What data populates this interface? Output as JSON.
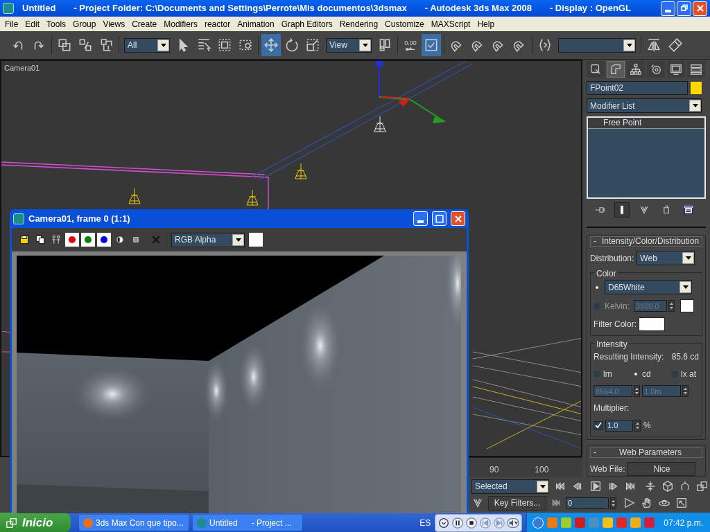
{
  "window": {
    "title_parts": [
      "Untitled",
      "- Project Folder: C:\\Documents and Settings\\Perrote\\Mis documentos\\3dsmax",
      "- Autodesk 3ds Max 2008",
      "- Display : OpenGL"
    ]
  },
  "menu": [
    "File",
    "Edit",
    "Tools",
    "Group",
    "Views",
    "Create",
    "Modifiers",
    "reactor",
    "Animation",
    "Graph Editors",
    "Rendering",
    "Customize",
    "MAXScript",
    "Help"
  ],
  "toolbar": {
    "items": [
      {
        "kind": "undo",
        "selected": false
      },
      {
        "kind": "redo",
        "selected": false
      },
      {
        "kind": "sep"
      },
      {
        "kind": "link",
        "selected": false
      },
      {
        "kind": "unlink",
        "selected": false
      },
      {
        "kind": "bind",
        "selected": false
      },
      {
        "kind": "sep"
      },
      {
        "kind": "dropdown",
        "value": "All"
      },
      {
        "kind": "pointer",
        "selected": false
      },
      {
        "kind": "list-pointer",
        "selected": false
      },
      {
        "kind": "dashed-square",
        "selected": false
      },
      {
        "kind": "dashed-circle",
        "selected": false
      },
      {
        "kind": "sep"
      },
      {
        "kind": "move-arrows",
        "selected": true
      },
      {
        "kind": "rotate-arrow",
        "selected": false
      },
      {
        "kind": "scale-square",
        "selected": false
      },
      {
        "kind": "dropdown",
        "value": "View"
      },
      {
        "kind": "pivot",
        "selected": false
      },
      {
        "kind": "sep"
      },
      {
        "kind": "spinner",
        "label": "0.00",
        "selected": false
      },
      {
        "kind": "checkbox-square",
        "selected": true
      },
      {
        "kind": "sep"
      },
      {
        "kind": "magnet",
        "selected": false
      },
      {
        "kind": "magnet",
        "selected": false
      },
      {
        "kind": "magnet",
        "selected": false
      },
      {
        "kind": "magnet",
        "selected": false
      },
      {
        "kind": "sep"
      },
      {
        "kind": "braces-pointer",
        "selected": false
      },
      {
        "kind": "dropdown"
      },
      {
        "kind": "sep"
      },
      {
        "kind": "mirror",
        "selected": false
      },
      {
        "kind": "eraser",
        "selected": false
      }
    ]
  },
  "viewport": {
    "label": "Camera01",
    "timeline_ticks": [
      "90",
      "100"
    ]
  },
  "render_window": {
    "title": "Camera01, frame 0 (1:1)",
    "tools": [
      {
        "kind": "floppy"
      },
      {
        "kind": "copy-pages"
      },
      {
        "kind": "people"
      },
      {
        "kind": "channel",
        "color": "#e00000"
      },
      {
        "kind": "channel",
        "color": "#008000"
      },
      {
        "kind": "channel",
        "color": "#0000e0"
      },
      {
        "kind": "half-circle"
      },
      {
        "kind": "small-square"
      },
      {
        "kind": "cross"
      }
    ],
    "channel_dropdown": "RGB Alpha"
  },
  "command_panel": {
    "tabs": [
      {
        "kind": "cursor-square",
        "selected": false
      },
      {
        "kind": "pipe",
        "selected": true
      },
      {
        "kind": "hierarchy",
        "selected": false
      },
      {
        "kind": "motion",
        "selected": false
      },
      {
        "kind": "monitor",
        "selected": false
      },
      {
        "kind": "bars",
        "selected": false
      }
    ],
    "object_name": "FPoint02",
    "modifier_dropdown": "Modifier List",
    "stack": [
      {
        "label": "Free Point",
        "selected": false
      }
    ],
    "stack_tools": [
      {
        "kind": "pin",
        "selected": false
      },
      {
        "kind": "bar",
        "selected": true
      },
      {
        "kind": "fork",
        "selected": false
      },
      {
        "kind": "can",
        "selected": false
      },
      {
        "kind": "window",
        "selected": false
      }
    ],
    "intensity_rollout": {
      "sign": "-",
      "title": "Intensity/Color/Distribution",
      "distribution_label": "Distribution:",
      "distribution": "Web",
      "color_group": {
        "title": "Color",
        "options": [
          {
            "kind": "preset",
            "value": "D65White",
            "selected": true,
            "disabled": false
          },
          {
            "kind": "kelvin",
            "label": "Kelvin:",
            "value": "3600.0",
            "selected": false,
            "disabled": true
          }
        ],
        "filter_label": "Filter Color:"
      },
      "intensity_group": {
        "title": "Intensity",
        "resulting_label": "Resulting Intensity:",
        "resulting_value": "85.6 cd",
        "units": [
          {
            "label": "lm",
            "selected": false
          },
          {
            "label": "cd",
            "selected": true
          },
          {
            "label": "lx at",
            "selected": false
          }
        ],
        "fields": [
          {
            "value": "8564.0",
            "disabled": true
          },
          {
            "value": "1.0m",
            "disabled": true
          }
        ],
        "multiplier_label": "Multiplier:",
        "multiplier_checked": true,
        "multiplier_value": "1.0",
        "multiplier_unit": "%"
      }
    },
    "web_rollout": {
      "sign": "-",
      "title": "Web Parameters",
      "web_file_label": "Web File:",
      "web_file": "Nice"
    }
  },
  "anim_bar": {
    "key_mode": "Selected",
    "key_filters": "Key Filters...",
    "frame": "0",
    "playback": [
      {
        "kind": "first"
      },
      {
        "kind": "prev"
      },
      {
        "kind": "play"
      },
      {
        "kind": "next"
      },
      {
        "kind": "last"
      }
    ],
    "nav": [
      {
        "kind": "zoom-arrows"
      },
      {
        "kind": "cube"
      },
      {
        "kind": "orbit"
      },
      {
        "kind": "boxes"
      },
      {
        "kind": "triangle"
      },
      {
        "kind": "hand"
      },
      {
        "kind": "ring"
      },
      {
        "kind": "maximize"
      }
    ]
  },
  "taskbar": {
    "start": "Inicio",
    "tasks": [
      {
        "label": "3ds Max Con que tipo...",
        "selected": false
      },
      {
        "label": "Untitled      - Project ...",
        "selected": false
      }
    ],
    "language": "ES",
    "media": [
      {
        "kind": "chevron"
      },
      {
        "kind": "pause"
      },
      {
        "kind": "stop"
      },
      {
        "kind": "prev"
      },
      {
        "kind": "next"
      },
      {
        "kind": "volume"
      }
    ],
    "tray": [
      {
        "color": "#e87a1a"
      },
      {
        "color": "#9acd32"
      },
      {
        "color": "#cc2020"
      },
      {
        "color": "#4a90c0"
      },
      {
        "color": "#f0c020"
      },
      {
        "color": "#e02828"
      },
      {
        "color": "#e8b020"
      },
      {
        "color": "#d02040"
      }
    ],
    "clock": "07:42 p.m."
  }
}
